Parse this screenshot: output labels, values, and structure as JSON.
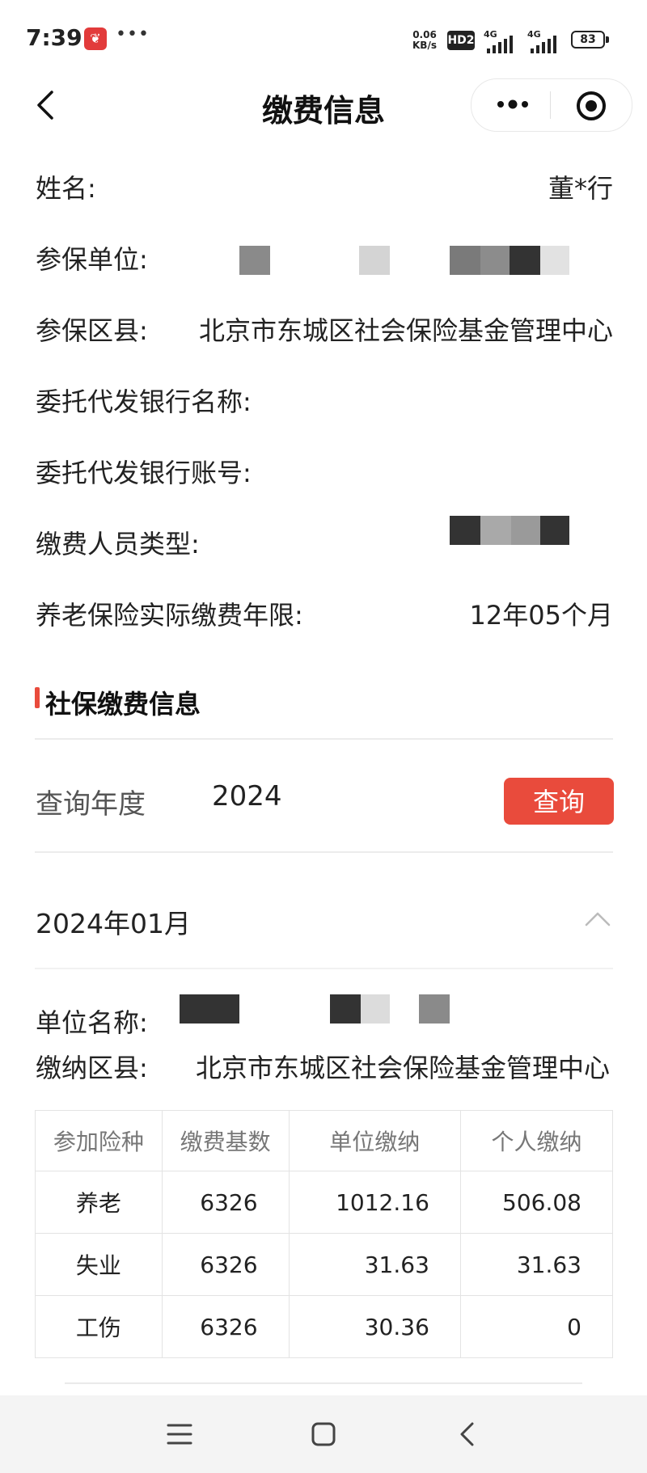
{
  "status_bar": {
    "time": "7:39",
    "speed_value": "0.06",
    "speed_unit": "KB/s",
    "hd": "HD2",
    "net1": "4G",
    "net2": "4G",
    "battery": "83"
  },
  "nav": {
    "title": "缴费信息"
  },
  "info": {
    "name_label": "姓名:",
    "name_value": "董*行",
    "unit_label": "参保单位:",
    "district_label": "参保区县:",
    "district_value": "北京市东城区社会保险基金管理中心",
    "bank_name_label": "委托代发银行名称:",
    "bank_account_label": "委托代发银行账号:",
    "person_type_label": "缴费人员类型:",
    "pension_years_label": "养老保险实际缴费年限:",
    "pension_years_value": "12年05个月"
  },
  "section": {
    "title": "社保缴费信息"
  },
  "query": {
    "label": "查询年度",
    "year": "2024",
    "button": "查询"
  },
  "month_block": {
    "month": "2024年01月",
    "unit_name_label": "单位名称:",
    "district_label": "缴纳区县:",
    "district_value": "北京市东城区社会保险基金管理中心"
  },
  "table": {
    "headers": [
      "参加险种",
      "缴费基数",
      "单位缴纳",
      "个人缴纳"
    ],
    "rows": [
      [
        "养老",
        "6326",
        "1012.16",
        "506.08"
      ],
      [
        "失业",
        "6326",
        "31.63",
        "31.63"
      ],
      [
        "工伤",
        "6326",
        "30.36",
        "0"
      ]
    ]
  },
  "colors": {
    "accent": "#e94b3c"
  }
}
